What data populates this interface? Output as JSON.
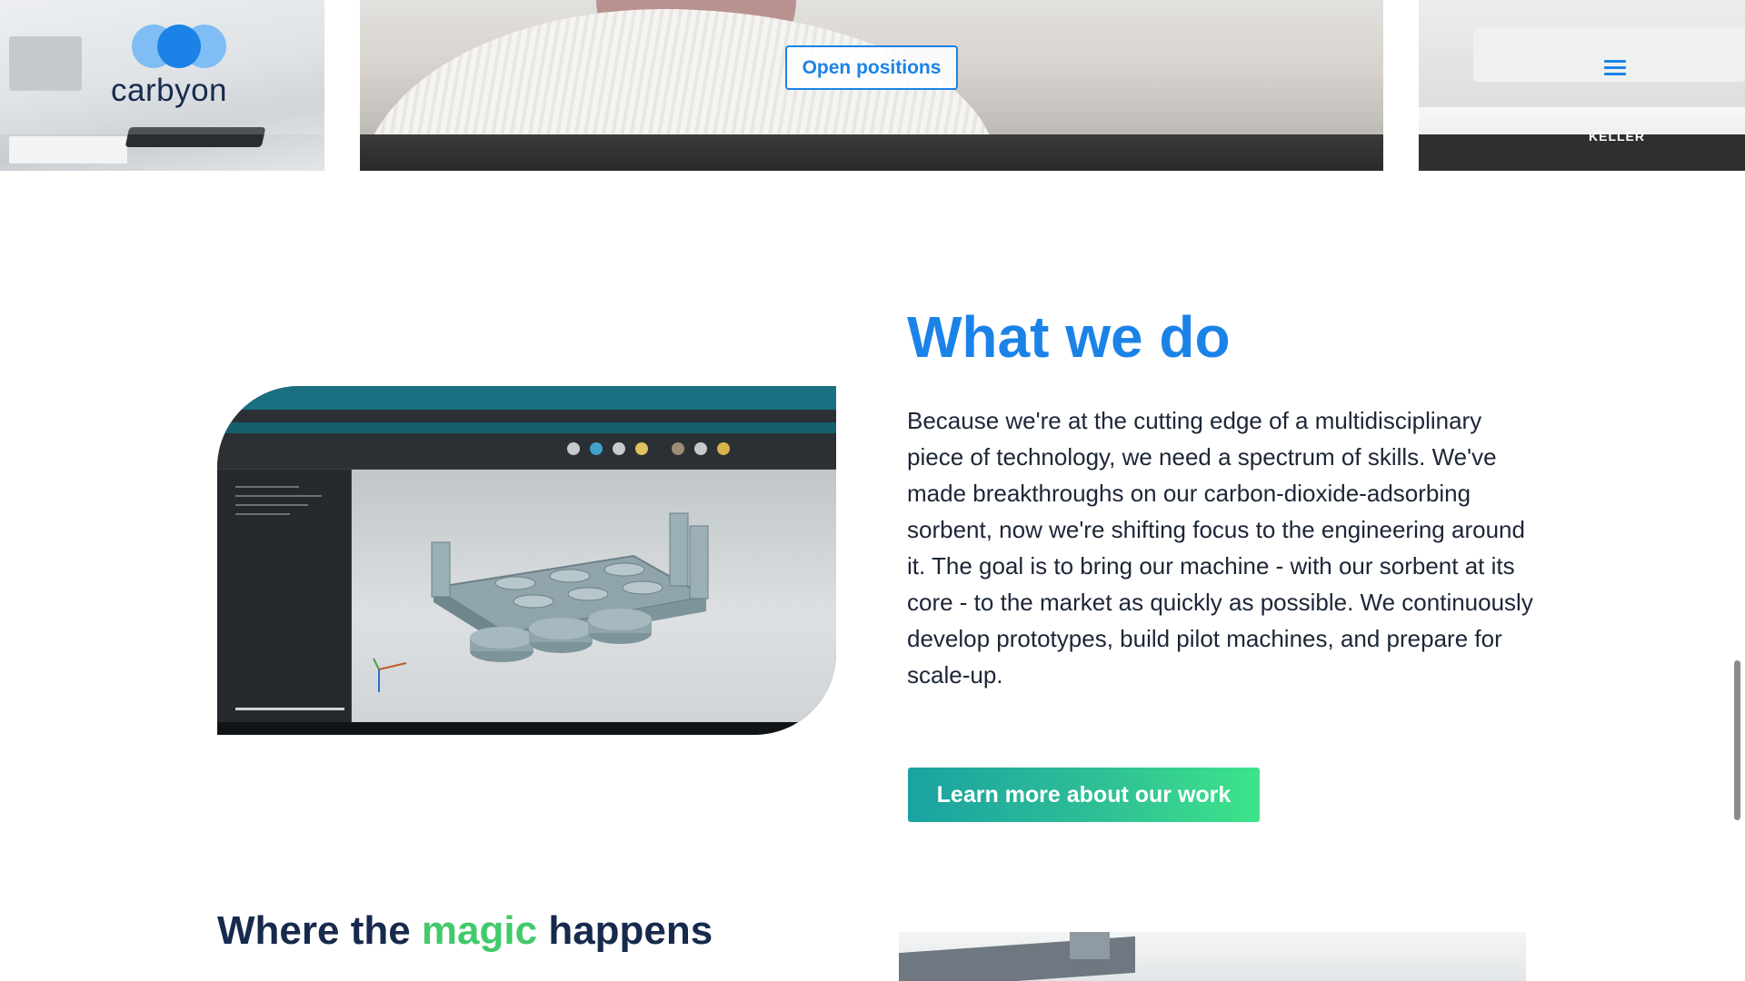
{
  "header": {
    "logo_text": "carbyon",
    "open_positions_label": "Open positions",
    "menu_icon": "hamburger-menu-icon"
  },
  "photo_strip": {
    "right_photo_sign": "KELLER"
  },
  "what_we_do": {
    "title": "What we do",
    "body": "Because we're at the cutting edge of a multidisciplinary piece of technology, we need a spectrum of skills. We've made breakthroughs on our carbon-dioxide-adsorbing sorbent, now we're shifting focus to the engineering around it. The goal is to bring our machine - with our sorbent at its core - to the market as quickly as possible. We continuously develop prototypes, build pilot machines, and prepare for scale-up.",
    "cta_label": "Learn more about our work"
  },
  "magic_section": {
    "title_before": "Where the ",
    "title_highlight": "magic",
    "title_after": " happens"
  },
  "colors": {
    "brand_blue": "#1b83e8",
    "navy": "#172a4d",
    "highlight_green": "#41c96a",
    "cta_gradient_start": "#1ba2a2",
    "cta_gradient_end": "#3de48a"
  }
}
